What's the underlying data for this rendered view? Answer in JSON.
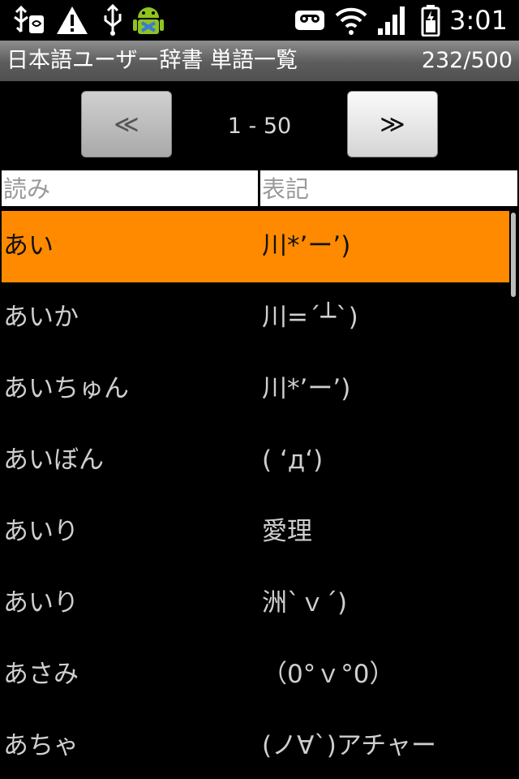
{
  "status_bar": {
    "time": "3:01",
    "icons": [
      "usb-debug-icon",
      "warning-icon",
      "usb-icon",
      "android-icon",
      "voicemail-icon",
      "wifi-icon",
      "signal-icon",
      "battery-icon"
    ]
  },
  "title_bar": {
    "title": "日本語ユーザー辞書 単語一覧",
    "count": "232/500"
  },
  "pager": {
    "prev_label": "≪",
    "next_label": "≫",
    "range": "1 - 50"
  },
  "columns": {
    "reading": "読み",
    "notation": "表記"
  },
  "rows": [
    {
      "reading": "あい",
      "notation": "川*’ー’)"
    },
    {
      "reading": "あいか",
      "notation": "川=´┴`)"
    },
    {
      "reading": "あいちゅん",
      "notation": "川*’ー’)"
    },
    {
      "reading": "あいぼん",
      "notation": "( ‘д‘)"
    },
    {
      "reading": "あいり",
      "notation": "愛理"
    },
    {
      "reading": "あいり",
      "notation": "洲`ｖ´)"
    },
    {
      "reading": "あさみ",
      "notation": "（0°ｖ°0）"
    },
    {
      "reading": "あちゃ",
      "notation": "(ノ∀`)アチャー"
    }
  ],
  "colors": {
    "selected_row": "#ff8a00",
    "background": "#000000"
  }
}
